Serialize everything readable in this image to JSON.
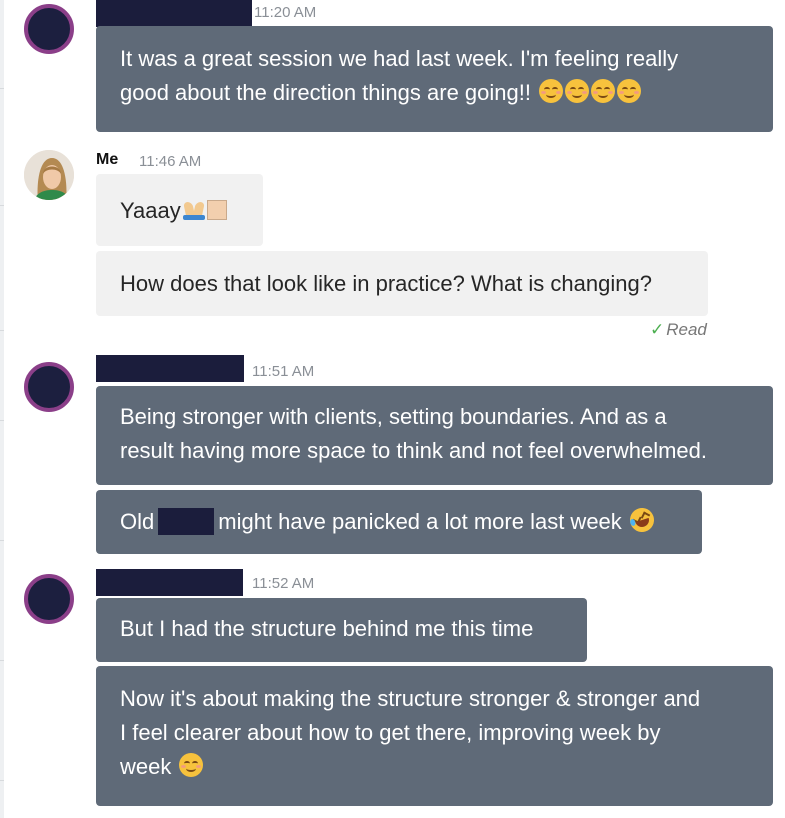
{
  "thread": {
    "group1": {
      "time": "11:20 AM",
      "messages": [
        {
          "parts": [
            "It was a great session we had last week. I'm feeling really",
            "good about the direction things are going!! "
          ]
        }
      ],
      "emojis": [
        "relieved-face",
        "relieved-face",
        "relieved-face",
        "relieved-face"
      ]
    },
    "group2": {
      "sender": "Me",
      "time": "11:46 AM",
      "msg1": "Yaaay",
      "msg1_emojis": [
        "folded-hands",
        "skin-tone-modifier"
      ],
      "msg2": "How does that look like in practice? What is changing?",
      "status": "Read"
    },
    "group3": {
      "time": "11:51 AM",
      "msg1_line1": "Being stronger with clients, setting boundaries. And as a",
      "msg1_line2": "result having more space to think and not feel overwhelmed.",
      "msg2_before": "Old",
      "msg2_after": "might have panicked a lot more last week",
      "msg2_emoji": "rolling-on-floor-laughing"
    },
    "group4": {
      "time": "11:52 AM",
      "msg1": "But I had the structure behind me this time",
      "msg2_line1": "Now it's about making the structure stronger & stronger and",
      "msg2_line2": "I feel clearer about how to get there, improving week by",
      "msg2_line3": "week",
      "msg2_emoji": "relieved-face"
    }
  },
  "colors": {
    "bubble_dark": "#5f6a78",
    "bubble_light": "#f1f1f1",
    "avatar_ring": "#8b3f89",
    "redaction": "#1b1d3c",
    "read_check": "#4caf50"
  }
}
